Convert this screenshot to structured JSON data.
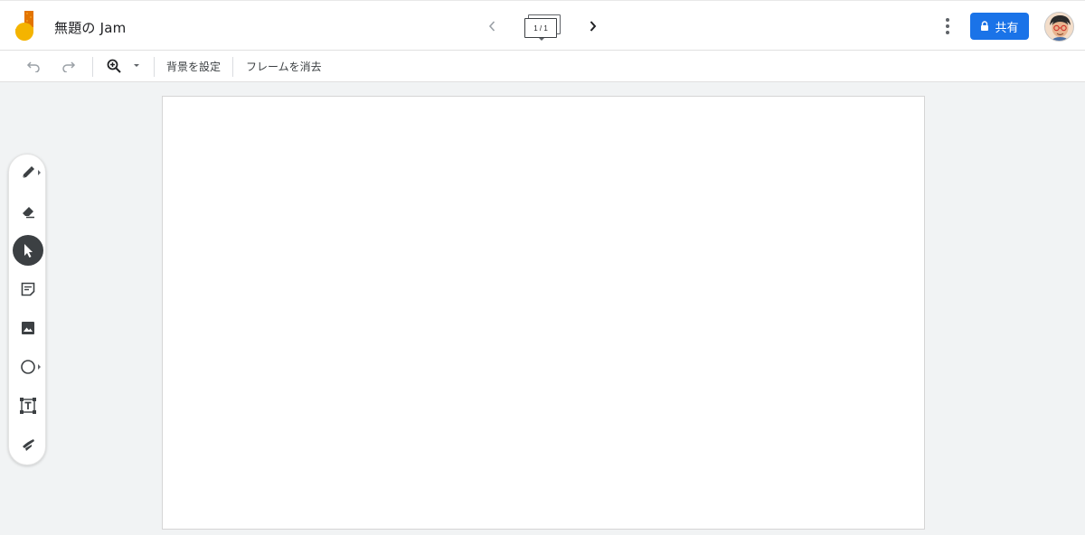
{
  "header": {
    "title": "無題の Jam",
    "frame_indicator": "1 / 1",
    "share_label": "共有",
    "icons": {
      "logo": "jamboard-logo",
      "prev": "chevron-left-icon",
      "next": "chevron-right-icon",
      "more": "more-vert-icon",
      "lock": "lock-icon"
    },
    "colors": {
      "share_button": "#1a73e8",
      "logo_yellow": "#f4b400",
      "logo_orange": "#e37400"
    }
  },
  "toolbar": {
    "set_background_label": "背景を設定",
    "clear_frame_label": "フレームを消去",
    "icons": [
      "undo-icon",
      "redo-icon",
      "zoom-in-icon",
      "dropdown-caret-icon"
    ]
  },
  "tools": [
    {
      "name": "pen",
      "icon": "pen-icon",
      "active": false,
      "has_submenu": true
    },
    {
      "name": "eraser",
      "icon": "eraser-icon",
      "active": false,
      "has_submenu": false
    },
    {
      "name": "select",
      "icon": "cursor-arrow-icon",
      "active": true,
      "has_submenu": false
    },
    {
      "name": "sticky-note",
      "icon": "sticky-note-icon",
      "active": false,
      "has_submenu": false
    },
    {
      "name": "image",
      "icon": "image-icon",
      "active": false,
      "has_submenu": false
    },
    {
      "name": "circle",
      "icon": "circle-shape-icon",
      "active": false,
      "has_submenu": true
    },
    {
      "name": "text-box",
      "icon": "text-box-icon",
      "active": false,
      "has_submenu": false
    },
    {
      "name": "laser",
      "icon": "laser-pointer-icon",
      "active": false,
      "has_submenu": false
    }
  ]
}
